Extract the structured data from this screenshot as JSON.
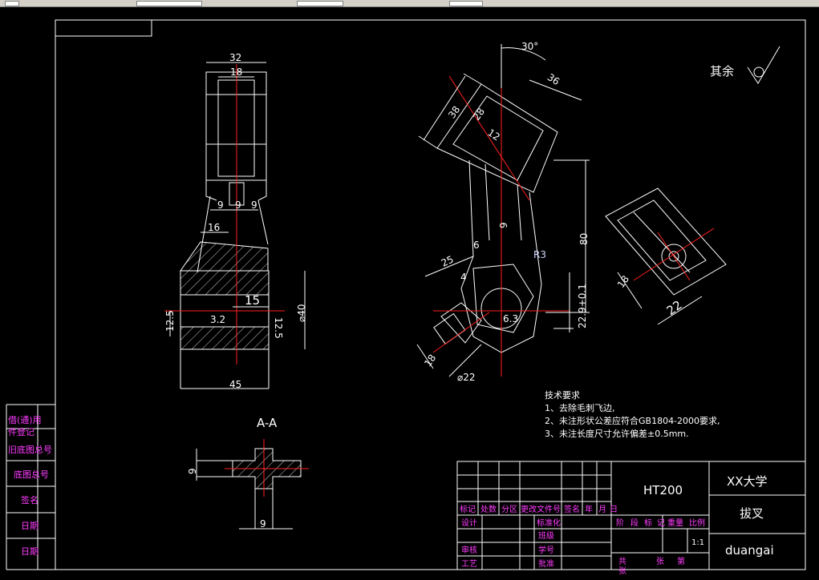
{
  "dimensions": {
    "d32": "32",
    "d18": "18",
    "d9a": "9",
    "d9b": "9",
    "d9c": "9",
    "d16": "16",
    "d15": "15",
    "d40": "⌀40",
    "d45": "45",
    "r125": "12.5",
    "r32": "3.2",
    "r125b": "12.5",
    "d30deg": "30°",
    "d38": "38",
    "d28": "28",
    "d36": "36",
    "d12": "12",
    "d9v": "9",
    "d6": "6",
    "d25": "25",
    "d4": "4",
    "r3": "R3",
    "d80": "80",
    "d22tol": "22.9+0.1",
    "r63": "6.3",
    "d22dia": "⌀22",
    "d16s": "16",
    "d18s": "18",
    "d22s": "22",
    "sec_9a": "9",
    "sec_9b": "9"
  },
  "section_label": "A-A",
  "roughness_note": "其余",
  "tech": {
    "title": "技术要求",
    "lines": [
      "1、去除毛刺飞边,",
      "2、未注形状公差应符合GB1804-2000要求,",
      "3、未注长度尺寸允许偏差±0.5mm."
    ]
  },
  "left_block": [
    "借(通)用",
    "件登记",
    "旧底图总号",
    "底图总号",
    "签名",
    "日期",
    "日期"
  ],
  "title_block": {
    "material": "HT200",
    "school": "XX大学",
    "part_name": "拔叉",
    "code": "duangai",
    "header_row": [
      "标记",
      "处数",
      "分区",
      "更改文件号",
      "签名",
      "年",
      "月",
      "日"
    ],
    "rows": [
      "设计",
      "审核",
      "工艺"
    ],
    "mid_labels": [
      "标准化",
      "班级",
      "学号",
      "批准"
    ],
    "stage_row": [
      "阶",
      "段",
      "标",
      "记",
      "重量",
      "比例"
    ],
    "scale": "1:1",
    "sheet_row": [
      "共",
      "张",
      "第",
      "张"
    ]
  }
}
